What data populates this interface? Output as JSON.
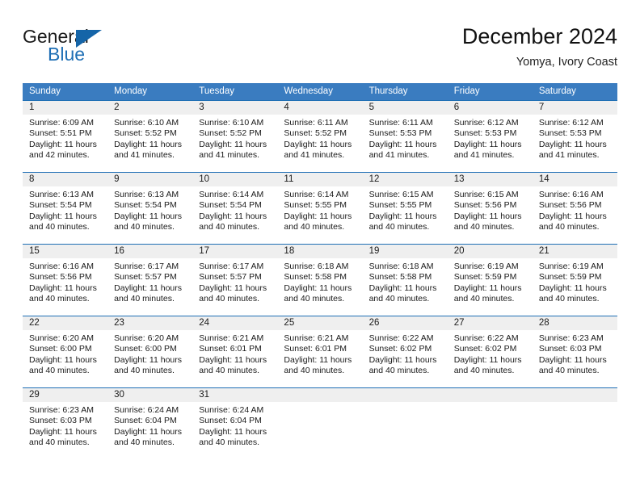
{
  "brand": {
    "name_part1": "General",
    "name_part2": "Blue",
    "triangle_icon": "triangle-icon",
    "accent_color": "#1565a8"
  },
  "header": {
    "title": "December 2024",
    "location": "Yomya, Ivory Coast"
  },
  "colors": {
    "weekday_header_bg": "#3a7cc0",
    "weekday_header_text": "#ffffff",
    "daynum_band_bg": "#efefef",
    "week_separator": "#1f6fb5",
    "body_text": "#1a1a1a"
  },
  "calendar": {
    "weekdays": [
      "Sunday",
      "Monday",
      "Tuesday",
      "Wednesday",
      "Thursday",
      "Friday",
      "Saturday"
    ],
    "weeks": [
      {
        "days": [
          {
            "num": "1",
            "sunrise": "Sunrise: 6:09 AM",
            "sunset": "Sunset: 5:51 PM",
            "daylight_line1": "Daylight: 11 hours",
            "daylight_line2": "and 42 minutes."
          },
          {
            "num": "2",
            "sunrise": "Sunrise: 6:10 AM",
            "sunset": "Sunset: 5:52 PM",
            "daylight_line1": "Daylight: 11 hours",
            "daylight_line2": "and 41 minutes."
          },
          {
            "num": "3",
            "sunrise": "Sunrise: 6:10 AM",
            "sunset": "Sunset: 5:52 PM",
            "daylight_line1": "Daylight: 11 hours",
            "daylight_line2": "and 41 minutes."
          },
          {
            "num": "4",
            "sunrise": "Sunrise: 6:11 AM",
            "sunset": "Sunset: 5:52 PM",
            "daylight_line1": "Daylight: 11 hours",
            "daylight_line2": "and 41 minutes."
          },
          {
            "num": "5",
            "sunrise": "Sunrise: 6:11 AM",
            "sunset": "Sunset: 5:53 PM",
            "daylight_line1": "Daylight: 11 hours",
            "daylight_line2": "and 41 minutes."
          },
          {
            "num": "6",
            "sunrise": "Sunrise: 6:12 AM",
            "sunset": "Sunset: 5:53 PM",
            "daylight_line1": "Daylight: 11 hours",
            "daylight_line2": "and 41 minutes."
          },
          {
            "num": "7",
            "sunrise": "Sunrise: 6:12 AM",
            "sunset": "Sunset: 5:53 PM",
            "daylight_line1": "Daylight: 11 hours",
            "daylight_line2": "and 41 minutes."
          }
        ]
      },
      {
        "days": [
          {
            "num": "8",
            "sunrise": "Sunrise: 6:13 AM",
            "sunset": "Sunset: 5:54 PM",
            "daylight_line1": "Daylight: 11 hours",
            "daylight_line2": "and 40 minutes."
          },
          {
            "num": "9",
            "sunrise": "Sunrise: 6:13 AM",
            "sunset": "Sunset: 5:54 PM",
            "daylight_line1": "Daylight: 11 hours",
            "daylight_line2": "and 40 minutes."
          },
          {
            "num": "10",
            "sunrise": "Sunrise: 6:14 AM",
            "sunset": "Sunset: 5:54 PM",
            "daylight_line1": "Daylight: 11 hours",
            "daylight_line2": "and 40 minutes."
          },
          {
            "num": "11",
            "sunrise": "Sunrise: 6:14 AM",
            "sunset": "Sunset: 5:55 PM",
            "daylight_line1": "Daylight: 11 hours",
            "daylight_line2": "and 40 minutes."
          },
          {
            "num": "12",
            "sunrise": "Sunrise: 6:15 AM",
            "sunset": "Sunset: 5:55 PM",
            "daylight_line1": "Daylight: 11 hours",
            "daylight_line2": "and 40 minutes."
          },
          {
            "num": "13",
            "sunrise": "Sunrise: 6:15 AM",
            "sunset": "Sunset: 5:56 PM",
            "daylight_line1": "Daylight: 11 hours",
            "daylight_line2": "and 40 minutes."
          },
          {
            "num": "14",
            "sunrise": "Sunrise: 6:16 AM",
            "sunset": "Sunset: 5:56 PM",
            "daylight_line1": "Daylight: 11 hours",
            "daylight_line2": "and 40 minutes."
          }
        ]
      },
      {
        "days": [
          {
            "num": "15",
            "sunrise": "Sunrise: 6:16 AM",
            "sunset": "Sunset: 5:56 PM",
            "daylight_line1": "Daylight: 11 hours",
            "daylight_line2": "and 40 minutes."
          },
          {
            "num": "16",
            "sunrise": "Sunrise: 6:17 AM",
            "sunset": "Sunset: 5:57 PM",
            "daylight_line1": "Daylight: 11 hours",
            "daylight_line2": "and 40 minutes."
          },
          {
            "num": "17",
            "sunrise": "Sunrise: 6:17 AM",
            "sunset": "Sunset: 5:57 PM",
            "daylight_line1": "Daylight: 11 hours",
            "daylight_line2": "and 40 minutes."
          },
          {
            "num": "18",
            "sunrise": "Sunrise: 6:18 AM",
            "sunset": "Sunset: 5:58 PM",
            "daylight_line1": "Daylight: 11 hours",
            "daylight_line2": "and 40 minutes."
          },
          {
            "num": "19",
            "sunrise": "Sunrise: 6:18 AM",
            "sunset": "Sunset: 5:58 PM",
            "daylight_line1": "Daylight: 11 hours",
            "daylight_line2": "and 40 minutes."
          },
          {
            "num": "20",
            "sunrise": "Sunrise: 6:19 AM",
            "sunset": "Sunset: 5:59 PM",
            "daylight_line1": "Daylight: 11 hours",
            "daylight_line2": "and 40 minutes."
          },
          {
            "num": "21",
            "sunrise": "Sunrise: 6:19 AM",
            "sunset": "Sunset: 5:59 PM",
            "daylight_line1": "Daylight: 11 hours",
            "daylight_line2": "and 40 minutes."
          }
        ]
      },
      {
        "days": [
          {
            "num": "22",
            "sunrise": "Sunrise: 6:20 AM",
            "sunset": "Sunset: 6:00 PM",
            "daylight_line1": "Daylight: 11 hours",
            "daylight_line2": "and 40 minutes."
          },
          {
            "num": "23",
            "sunrise": "Sunrise: 6:20 AM",
            "sunset": "Sunset: 6:00 PM",
            "daylight_line1": "Daylight: 11 hours",
            "daylight_line2": "and 40 minutes."
          },
          {
            "num": "24",
            "sunrise": "Sunrise: 6:21 AM",
            "sunset": "Sunset: 6:01 PM",
            "daylight_line1": "Daylight: 11 hours",
            "daylight_line2": "and 40 minutes."
          },
          {
            "num": "25",
            "sunrise": "Sunrise: 6:21 AM",
            "sunset": "Sunset: 6:01 PM",
            "daylight_line1": "Daylight: 11 hours",
            "daylight_line2": "and 40 minutes."
          },
          {
            "num": "26",
            "sunrise": "Sunrise: 6:22 AM",
            "sunset": "Sunset: 6:02 PM",
            "daylight_line1": "Daylight: 11 hours",
            "daylight_line2": "and 40 minutes."
          },
          {
            "num": "27",
            "sunrise": "Sunrise: 6:22 AM",
            "sunset": "Sunset: 6:02 PM",
            "daylight_line1": "Daylight: 11 hours",
            "daylight_line2": "and 40 minutes."
          },
          {
            "num": "28",
            "sunrise": "Sunrise: 6:23 AM",
            "sunset": "Sunset: 6:03 PM",
            "daylight_line1": "Daylight: 11 hours",
            "daylight_line2": "and 40 minutes."
          }
        ]
      },
      {
        "days": [
          {
            "num": "29",
            "sunrise": "Sunrise: 6:23 AM",
            "sunset": "Sunset: 6:03 PM",
            "daylight_line1": "Daylight: 11 hours",
            "daylight_line2": "and 40 minutes."
          },
          {
            "num": "30",
            "sunrise": "Sunrise: 6:24 AM",
            "sunset": "Sunset: 6:04 PM",
            "daylight_line1": "Daylight: 11 hours",
            "daylight_line2": "and 40 minutes."
          },
          {
            "num": "31",
            "sunrise": "Sunrise: 6:24 AM",
            "sunset": "Sunset: 6:04 PM",
            "daylight_line1": "Daylight: 11 hours",
            "daylight_line2": "and 40 minutes."
          },
          {
            "num": "",
            "sunrise": "",
            "sunset": "",
            "daylight_line1": "",
            "daylight_line2": ""
          },
          {
            "num": "",
            "sunrise": "",
            "sunset": "",
            "daylight_line1": "",
            "daylight_line2": ""
          },
          {
            "num": "",
            "sunrise": "",
            "sunset": "",
            "daylight_line1": "",
            "daylight_line2": ""
          },
          {
            "num": "",
            "sunrise": "",
            "sunset": "",
            "daylight_line1": "",
            "daylight_line2": ""
          }
        ]
      }
    ]
  }
}
